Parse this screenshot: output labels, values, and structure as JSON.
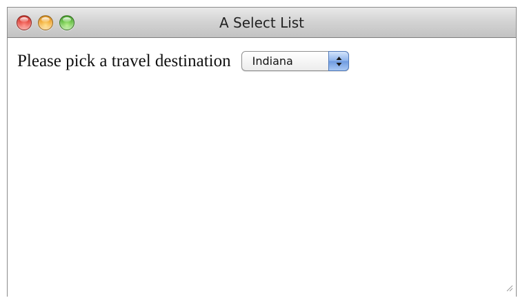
{
  "window": {
    "title": "A Select List"
  },
  "form": {
    "prompt": "Please pick a travel destination",
    "destination_select": {
      "selected": "Indiana",
      "stepper_icon": "up-down-arrows-icon"
    }
  },
  "colors": {
    "close_button": "#e2433a",
    "minimize_button": "#f0a52c",
    "zoom_button": "#5fbd3c",
    "select_stepper": "#6f9be0"
  }
}
